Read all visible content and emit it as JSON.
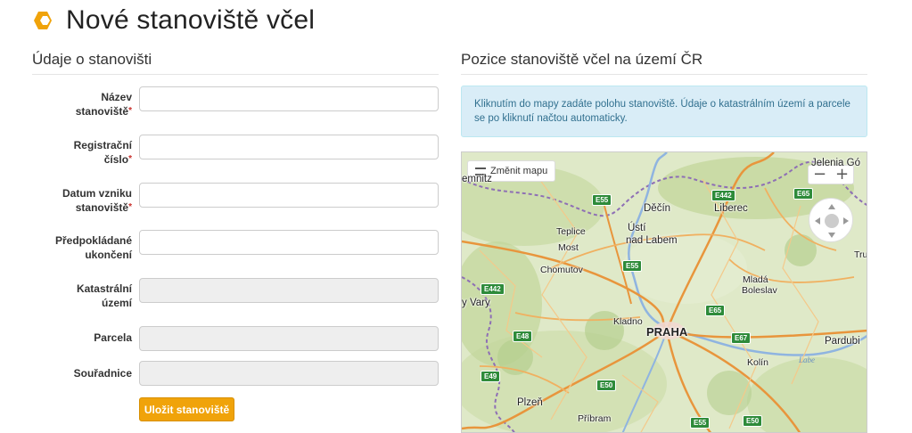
{
  "header": {
    "title": "Nové stanoviště včel",
    "logo_icon": "hexagon-logo-icon",
    "accent_color": "#f0a30a"
  },
  "left_section": {
    "heading": "Údaje o stanovišti"
  },
  "form": {
    "fields": [
      {
        "label_line1": "Název",
        "label_line2": "stanoviště",
        "required": "*",
        "value": ""
      },
      {
        "label_line1": "Registrační",
        "label_line2": "číslo",
        "required": "*",
        "value": ""
      },
      {
        "label_line1": "Datum vzniku",
        "label_line2": "stanoviště",
        "required": "*",
        "value": ""
      },
      {
        "label_line1": "Předpokládané",
        "label_line2": "ukončení",
        "required": "",
        "value": ""
      },
      {
        "label_line1": "Katastrální",
        "label_line2": "území",
        "required": "",
        "value": ""
      },
      {
        "label_line1": "Parcela",
        "label_line2": "",
        "required": "",
        "value": ""
      },
      {
        "label_line1": "Souřadnice",
        "label_line2": "",
        "required": "",
        "value": ""
      }
    ],
    "save_label": "Uložit stanoviště"
  },
  "right_section": {
    "heading": "Pozice stanoviště včel na území ČR",
    "info_text": "Kliknutím do mapy zadáte polohu stanoviště. Údaje o katastrálním území a parcele se po kliknutí načtou automaticky."
  },
  "map": {
    "change_map_label": "Změnit mapu",
    "zoom_out": "−",
    "zoom_in": "+",
    "cities": [
      "Jelenia Gó",
      "emnitz",
      "Děčín",
      "Liberec",
      "Teplice",
      "Ústí",
      "nad Labem",
      "Most",
      "Chomutov",
      "Tru",
      "Mladá",
      "Boleslav",
      "y Vary",
      "Kladno",
      "PRAHA",
      "Pardubi",
      "Kolín",
      "Plzeň",
      "Příbram"
    ],
    "roads": [
      "E55",
      "E442",
      "E55",
      "E442",
      "E65",
      "E48",
      "E67",
      "E49",
      "E50",
      "E55",
      "E50",
      "E65"
    ],
    "river": "Labe"
  }
}
